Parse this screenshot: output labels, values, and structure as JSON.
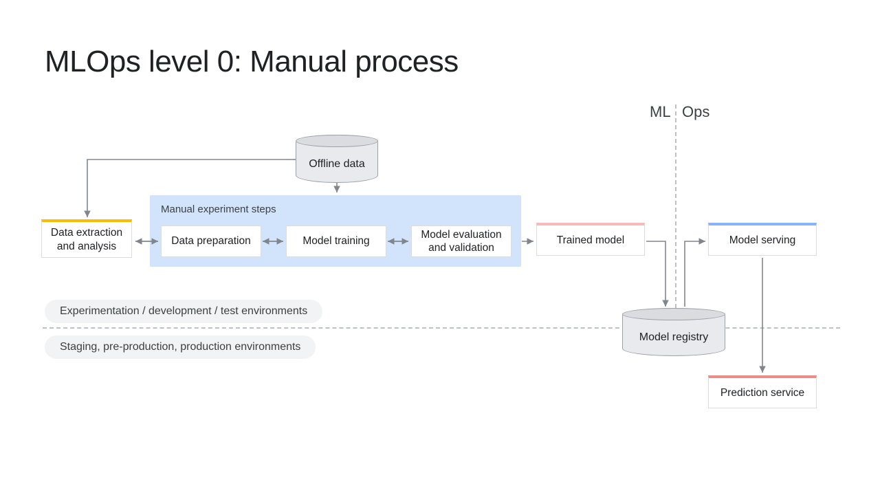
{
  "title": "MLOps level 0: Manual process",
  "sections": {
    "ml": "ML",
    "ops": "Ops"
  },
  "cylinders": {
    "offline": "Offline data",
    "registry": "Model registry"
  },
  "experiment_box_title": "Manual experiment steps",
  "nodes": {
    "extract": "Data extraction and analysis",
    "prep": "Data preparation",
    "train": "Model training",
    "eval": "Model evaluation and validation",
    "trained": "Trained model",
    "serve": "Model serving",
    "predict": "Prediction service"
  },
  "env_labels": {
    "top": "Experimentation / development / test environments",
    "bottom": "Staging, pre-production, production environments"
  }
}
